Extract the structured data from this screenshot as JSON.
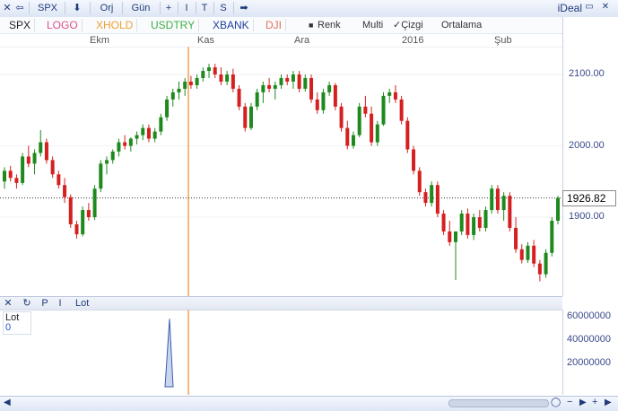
{
  "app": {
    "title": "iDeal"
  },
  "toolbar": {
    "symbol": "SPX",
    "down_arrow": "⬇",
    "orj_label": "Orj",
    "period_label": "Gün",
    "plus_label": "+",
    "i_label": "I",
    "t_label": "T",
    "s_label": "S",
    "fwd_label": "➡"
  },
  "symbols": [
    {
      "label": "SPX",
      "color": "#222222"
    },
    {
      "label": "LOGO",
      "color": "#e0508a"
    },
    {
      "label": "XHOLD",
      "color": "#f0a030"
    },
    {
      "label": "USDTRY",
      "color": "#3cb043"
    },
    {
      "label": "XBANK",
      "color": "#2040a0"
    },
    {
      "label": "DJI",
      "color": "#e07060"
    }
  ],
  "options": {
    "renk": "Renk",
    "multi": "Multi",
    "cizgi": "✓Çizgi",
    "ortalama": "Ortalama"
  },
  "time_axis": [
    "Ekm",
    "Kas",
    "Ara",
    "2016",
    "Şub"
  ],
  "price_axis": [
    "2100.00",
    "2000.00",
    "1900.00"
  ],
  "last_price": "1926.82",
  "lot_toolbar": {
    "close": "✕",
    "refresh": "↻",
    "p": "P",
    "i": "I",
    "name": "Lot"
  },
  "lot_legend": {
    "name": "Lot",
    "value": "0"
  },
  "volume_axis": [
    "60000000",
    "40000000",
    "20000000"
  ],
  "colors": {
    "up": "#1e8a1e",
    "down": "#d42020",
    "marker": "#f4b880"
  },
  "chart_data": {
    "type": "candlestick",
    "symbol": "SPX",
    "period": "daily",
    "y_range": [
      1800,
      2140
    ],
    "current_close": 1926.82,
    "ohlc": [
      [
        1950,
        1970,
        1940,
        1965
      ],
      [
        1965,
        1972,
        1950,
        1955
      ],
      [
        1955,
        1960,
        1940,
        1948
      ],
      [
        1948,
        1990,
        1945,
        1985
      ],
      [
        1985,
        2000,
        1970,
        1975
      ],
      [
        1975,
        1995,
        1960,
        1990
      ],
      [
        1990,
        2022,
        1985,
        2005
      ],
      [
        2005,
        2010,
        1975,
        1980
      ],
      [
        1980,
        1985,
        1955,
        1960
      ],
      [
        1960,
        1965,
        1940,
        1945
      ],
      [
        1945,
        1955,
        1920,
        1928
      ],
      [
        1928,
        1932,
        1885,
        1890
      ],
      [
        1890,
        1895,
        1870,
        1876
      ],
      [
        1876,
        1915,
        1873,
        1910
      ],
      [
        1910,
        1920,
        1895,
        1900
      ],
      [
        1900,
        1945,
        1896,
        1940
      ],
      [
        1940,
        1980,
        1935,
        1975
      ],
      [
        1975,
        1985,
        1960,
        1980
      ],
      [
        1980,
        1995,
        1975,
        1992
      ],
      [
        1992,
        2010,
        1985,
        2005
      ],
      [
        2005,
        2015,
        1995,
        2000
      ],
      [
        2000,
        2012,
        1992,
        2010
      ],
      [
        2010,
        2020,
        2002,
        2015
      ],
      [
        2015,
        2030,
        2008,
        2025
      ],
      [
        2025,
        2030,
        2005,
        2010
      ],
      [
        2010,
        2025,
        2005,
        2020
      ],
      [
        2020,
        2045,
        2015,
        2040
      ],
      [
        2040,
        2070,
        2035,
        2065
      ],
      [
        2065,
        2080,
        2055,
        2075
      ],
      [
        2075,
        2090,
        2065,
        2080
      ],
      [
        2080,
        2095,
        2070,
        2090
      ],
      [
        2090,
        2098,
        2080,
        2085
      ],
      [
        2085,
        2100,
        2080,
        2095
      ],
      [
        2095,
        2110,
        2090,
        2105
      ],
      [
        2105,
        2115,
        2095,
        2110
      ],
      [
        2110,
        2115,
        2095,
        2100
      ],
      [
        2100,
        2110,
        2085,
        2090
      ],
      [
        2090,
        2105,
        2085,
        2100
      ],
      [
        2100,
        2108,
        2075,
        2080
      ],
      [
        2080,
        2085,
        2050,
        2055
      ],
      [
        2055,
        2060,
        2020,
        2025
      ],
      [
        2025,
        2060,
        2022,
        2055
      ],
      [
        2055,
        2080,
        2050,
        2075
      ],
      [
        2075,
        2090,
        2060,
        2085
      ],
      [
        2085,
        2095,
        2075,
        2080
      ],
      [
        2080,
        2090,
        2065,
        2085
      ],
      [
        2085,
        2100,
        2080,
        2095
      ],
      [
        2095,
        2100,
        2085,
        2090
      ],
      [
        2090,
        2105,
        2080,
        2100
      ],
      [
        2100,
        2105,
        2075,
        2080
      ],
      [
        2080,
        2100,
        2076,
        2095
      ],
      [
        2095,
        2100,
        2060,
        2065
      ],
      [
        2065,
        2075,
        2045,
        2050
      ],
      [
        2050,
        2080,
        2045,
        2075
      ],
      [
        2075,
        2090,
        2070,
        2085
      ],
      [
        2085,
        2088,
        2050,
        2055
      ],
      [
        2055,
        2060,
        2020,
        2025
      ],
      [
        2025,
        2035,
        1995,
        2000
      ],
      [
        2000,
        2020,
        1996,
        2015
      ],
      [
        2015,
        2060,
        2012,
        2055
      ],
      [
        2055,
        2070,
        2040,
        2045
      ],
      [
        2045,
        2055,
        2000,
        2005
      ],
      [
        2005,
        2035,
        2000,
        2030
      ],
      [
        2030,
        2075,
        2028,
        2070
      ],
      [
        2070,
        2080,
        2060,
        2075
      ],
      [
        2075,
        2085,
        2060,
        2065
      ],
      [
        2065,
        2070,
        2030,
        2035
      ],
      [
        2035,
        2040,
        1990,
        1995
      ],
      [
        1995,
        2000,
        1960,
        1965
      ],
      [
        1965,
        1970,
        1930,
        1935
      ],
      [
        1935,
        1940,
        1915,
        1920
      ],
      [
        1920,
        1950,
        1915,
        1945
      ],
      [
        1945,
        1950,
        1900,
        1905
      ],
      [
        1905,
        1910,
        1875,
        1880
      ],
      [
        1880,
        1895,
        1860,
        1865
      ],
      [
        1865,
        1870,
        1812,
        1880
      ],
      [
        1880,
        1910,
        1875,
        1905
      ],
      [
        1905,
        1912,
        1870,
        1875
      ],
      [
        1875,
        1905,
        1868,
        1900
      ],
      [
        1900,
        1910,
        1880,
        1885
      ],
      [
        1885,
        1915,
        1880,
        1910
      ],
      [
        1910,
        1945,
        1905,
        1940
      ],
      [
        1940,
        1945,
        1905,
        1910
      ],
      [
        1910,
        1935,
        1895,
        1930
      ],
      [
        1930,
        1935,
        1880,
        1885
      ],
      [
        1885,
        1900,
        1850,
        1855
      ],
      [
        1855,
        1862,
        1835,
        1840
      ],
      [
        1840,
        1865,
        1836,
        1860
      ],
      [
        1860,
        1868,
        1830,
        1835
      ],
      [
        1835,
        1840,
        1810,
        1820
      ],
      [
        1820,
        1855,
        1815,
        1850
      ],
      [
        1850,
        1900,
        1845,
        1895
      ],
      [
        1895,
        1930,
        1890,
        1927
      ]
    ],
    "volume": [
      0,
      0,
      0,
      0,
      0,
      0,
      0,
      0,
      0,
      0,
      0,
      0,
      0,
      0,
      0,
      0,
      0,
      0,
      0,
      0,
      0,
      0,
      0,
      0,
      0,
      0,
      0,
      0,
      0,
      0,
      0,
      0,
      0,
      0,
      0,
      0,
      0,
      0,
      0,
      0,
      0,
      0,
      0,
      0,
      0,
      0,
      0,
      0,
      0,
      0,
      0,
      0,
      0,
      0,
      0,
      0,
      0,
      0,
      0,
      0,
      0,
      0,
      0,
      0,
      0,
      0,
      0,
      0,
      0,
      0,
      0,
      0,
      0,
      0,
      0,
      0,
      0,
      0,
      0,
      0,
      0,
      0,
      0,
      0,
      0,
      0,
      0,
      0,
      0,
      0,
      0,
      0,
      0
    ],
    "volume_spike": 59000000,
    "volume_range": [
      0,
      64000000
    ]
  }
}
